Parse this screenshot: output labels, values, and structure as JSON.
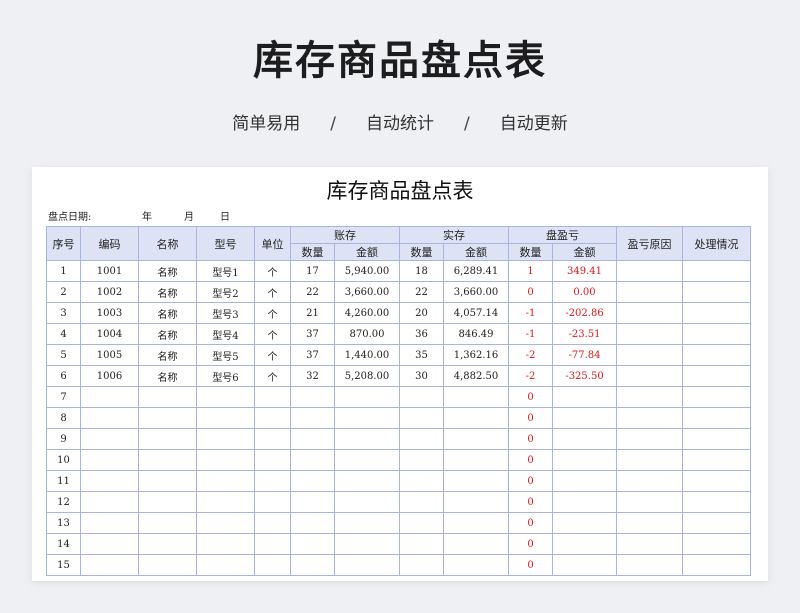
{
  "hero": {
    "title": "库存商品盘点表",
    "tags": [
      "简单易用",
      "自动统计",
      "自动更新"
    ],
    "separator": "/"
  },
  "sheet": {
    "title": "库存商品盘点表",
    "date_label": "盘点日期:",
    "year_label": "年",
    "month_label": "月",
    "day_label": "日",
    "headers": {
      "seq": "序号",
      "code": "编码",
      "name": "名称",
      "model": "型号",
      "unit": "单位",
      "book": "账存",
      "actual": "实存",
      "diff": "盘盈亏",
      "qty": "数量",
      "amount": "金额",
      "reason": "盈亏原因",
      "handling": "处理情况"
    },
    "rows": [
      {
        "seq": "1",
        "code": "1001",
        "name": "名称",
        "model": "型号1",
        "unit": "个",
        "book_qty": "17",
        "book_amt": "5,940.00",
        "act_qty": "18",
        "act_amt": "6,289.41",
        "diff_qty": "1",
        "diff_amt": "349.41"
      },
      {
        "seq": "2",
        "code": "1002",
        "name": "名称",
        "model": "型号2",
        "unit": "个",
        "book_qty": "22",
        "book_amt": "3,660.00",
        "act_qty": "22",
        "act_amt": "3,660.00",
        "diff_qty": "0",
        "diff_amt": "0.00"
      },
      {
        "seq": "3",
        "code": "1003",
        "name": "名称",
        "model": "型号3",
        "unit": "个",
        "book_qty": "21",
        "book_amt": "4,260.00",
        "act_qty": "20",
        "act_amt": "4,057.14",
        "diff_qty": "-1",
        "diff_amt": "-202.86"
      },
      {
        "seq": "4",
        "code": "1004",
        "name": "名称",
        "model": "型号4",
        "unit": "个",
        "book_qty": "37",
        "book_amt": "870.00",
        "act_qty": "36",
        "act_amt": "846.49",
        "diff_qty": "-1",
        "diff_amt": "-23.51"
      },
      {
        "seq": "5",
        "code": "1005",
        "name": "名称",
        "model": "型号5",
        "unit": "个",
        "book_qty": "37",
        "book_amt": "1,440.00",
        "act_qty": "35",
        "act_amt": "1,362.16",
        "diff_qty": "-2",
        "diff_amt": "-77.84"
      },
      {
        "seq": "6",
        "code": "1006",
        "name": "名称",
        "model": "型号6",
        "unit": "个",
        "book_qty": "32",
        "book_amt": "5,208.00",
        "act_qty": "30",
        "act_amt": "4,882.50",
        "diff_qty": "-2",
        "diff_amt": "-325.50"
      },
      {
        "seq": "7",
        "code": "",
        "name": "",
        "model": "",
        "unit": "",
        "book_qty": "",
        "book_amt": "",
        "act_qty": "",
        "act_amt": "",
        "diff_qty": "0",
        "diff_amt": ""
      },
      {
        "seq": "8",
        "code": "",
        "name": "",
        "model": "",
        "unit": "",
        "book_qty": "",
        "book_amt": "",
        "act_qty": "",
        "act_amt": "",
        "diff_qty": "0",
        "diff_amt": ""
      },
      {
        "seq": "9",
        "code": "",
        "name": "",
        "model": "",
        "unit": "",
        "book_qty": "",
        "book_amt": "",
        "act_qty": "",
        "act_amt": "",
        "diff_qty": "0",
        "diff_amt": ""
      },
      {
        "seq": "10",
        "code": "",
        "name": "",
        "model": "",
        "unit": "",
        "book_qty": "",
        "book_amt": "",
        "act_qty": "",
        "act_amt": "",
        "diff_qty": "0",
        "diff_amt": ""
      },
      {
        "seq": "11",
        "code": "",
        "name": "",
        "model": "",
        "unit": "",
        "book_qty": "",
        "book_amt": "",
        "act_qty": "",
        "act_amt": "",
        "diff_qty": "0",
        "diff_amt": ""
      },
      {
        "seq": "12",
        "code": "",
        "name": "",
        "model": "",
        "unit": "",
        "book_qty": "",
        "book_amt": "",
        "act_qty": "",
        "act_amt": "",
        "diff_qty": "0",
        "diff_amt": ""
      },
      {
        "seq": "13",
        "code": "",
        "name": "",
        "model": "",
        "unit": "",
        "book_qty": "",
        "book_amt": "",
        "act_qty": "",
        "act_amt": "",
        "diff_qty": "0",
        "diff_amt": ""
      },
      {
        "seq": "14",
        "code": "",
        "name": "",
        "model": "",
        "unit": "",
        "book_qty": "",
        "book_amt": "",
        "act_qty": "",
        "act_amt": "",
        "diff_qty": "0",
        "diff_amt": ""
      },
      {
        "seq": "15",
        "code": "",
        "name": "",
        "model": "",
        "unit": "",
        "book_qty": "",
        "book_amt": "",
        "act_qty": "",
        "act_amt": "",
        "diff_qty": "0",
        "diff_amt": ""
      }
    ]
  },
  "colors": {
    "background": "#eef0f3",
    "header_fill": "#dde3f4",
    "grid_line": "#a9b4df",
    "variance_text": "#e0151a"
  }
}
